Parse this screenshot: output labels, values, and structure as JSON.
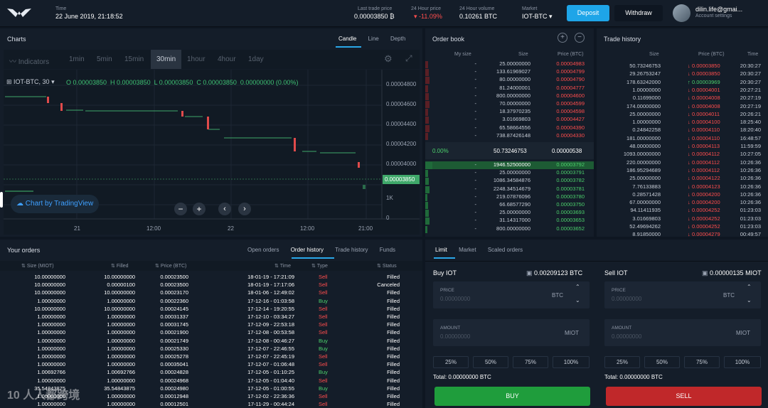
{
  "header": {
    "time_label": "Time",
    "time_value": "22 June 2019, 21:18:52",
    "last_price_label": "Last trade price",
    "last_price_value": "0.00003850 ₿",
    "change_label": "24 Hour price",
    "change_value": "-11.09%",
    "volume_label": "24 Hour volume",
    "volume_value": "0.10261 BTC",
    "market_label": "Market",
    "market_value": "IOT-BTC",
    "deposit": "Deposit",
    "withdraw": "Withdraw",
    "user": "dilin.life@gmai...",
    "account": "Account settings"
  },
  "charts": {
    "title": "Charts",
    "tabs": [
      "Candle",
      "Line",
      "Depth"
    ],
    "indicators": "Indicators",
    "intervals": [
      "1min",
      "5min",
      "15min",
      "30min",
      "1hour",
      "4hour",
      "1day"
    ],
    "symbol": "IOT-BTC, 30",
    "ohlc": "O 0.00003850  H 0.00003850  L 0.00003850  C 0.00003850  0.00000000 (0.00%)",
    "yticks": [
      "0.00004800",
      "0.00004600",
      "0.00004400",
      "0.00004200",
      "0.00004000"
    ],
    "current": "0.00003850",
    "vol_ticks": [
      "1K",
      "0"
    ],
    "xticks": [
      "21",
      "12:00",
      "22",
      "12:00",
      "21:00"
    ],
    "brand": "Chart by TradingView"
  },
  "orderbook": {
    "title": "Order book",
    "cols": [
      "My size",
      "Size",
      "Price (BTC)"
    ],
    "asks": [
      [
        "-",
        "25.00000000",
        "0.00004983"
      ],
      [
        "-",
        "133.61969027",
        "0.00004799"
      ],
      [
        "-",
        "80.00000000",
        "0.00004790"
      ],
      [
        "-",
        "81.24000001",
        "0.00004777"
      ],
      [
        "-",
        "800.00000000",
        "0.00004600"
      ],
      [
        "-",
        "70.00000000",
        "0.00004599"
      ],
      [
        "-",
        "18.37970235",
        "0.00004598"
      ],
      [
        "-",
        "3.01669803",
        "0.00004427"
      ],
      [
        "-",
        "65.58664556",
        "0.00004390"
      ],
      [
        "-",
        "738.87426148",
        "0.00004330"
      ]
    ],
    "spread": [
      "0.00%",
      "50.73246753",
      "0.00000538"
    ],
    "bids": [
      [
        "-",
        "1946.52500000",
        "0.00003792"
      ],
      [
        "-",
        "25.00000000",
        "0.00003791"
      ],
      [
        "-",
        "1086.34584876",
        "0.00003782"
      ],
      [
        "-",
        "2248.34514679",
        "0.00003781"
      ],
      [
        "-",
        "219.07876096",
        "0.00003780"
      ],
      [
        "-",
        "66.68577290",
        "0.00003750"
      ],
      [
        "-",
        "25.00000000",
        "0.00003693"
      ],
      [
        "-",
        "31.14317000",
        "0.00003653"
      ],
      [
        "-",
        "800.00000000",
        "0.00003652"
      ]
    ]
  },
  "trades": {
    "title": "Trade history",
    "cols": [
      "Size",
      "Price (BTC)",
      "Time"
    ],
    "rows": [
      [
        "50.73246753",
        "0.00003850",
        "20:30:27",
        "d"
      ],
      [
        "29.26753247",
        "0.00003850",
        "20:30:27",
        "d"
      ],
      [
        "178.63242000",
        "0.00003969",
        "20:30:27",
        "u"
      ],
      [
        "1.00000000",
        "0.00004001",
        "20:27:21",
        "d"
      ],
      [
        "0.11699000",
        "0.00004008",
        "20:27:19",
        "d"
      ],
      [
        "174.00000000",
        "0.00004008",
        "20:27:19",
        "d"
      ],
      [
        "25.00000000",
        "0.00004011",
        "20:26:21",
        "d"
      ],
      [
        "1.00000000",
        "0.00004100",
        "18:25:40",
        "d"
      ],
      [
        "0.24842258",
        "0.00004110",
        "18:20:40",
        "d"
      ],
      [
        "181.00000000",
        "0.00004110",
        "16:48:57",
        "d"
      ],
      [
        "48.00000000",
        "0.00004113",
        "11:59:59",
        "d"
      ],
      [
        "1093.00000000",
        "0.00004112",
        "10:27:05",
        "d"
      ],
      [
        "220.00000000",
        "0.00004112",
        "10:26:36",
        "d"
      ],
      [
        "186.95294689",
        "0.00004112",
        "10:26:36",
        "d"
      ],
      [
        "25.00000000",
        "0.00004122",
        "10:26:36",
        "d"
      ],
      [
        "7.76133883",
        "0.00004123",
        "10:26:36",
        "d"
      ],
      [
        "0.28571428",
        "0.00004200",
        "10:26:36",
        "d"
      ],
      [
        "67.00000000",
        "0.00004200",
        "10:26:36",
        "d"
      ],
      [
        "94.11411935",
        "0.00004252",
        "01:23:03",
        "d"
      ],
      [
        "3.01669803",
        "0.00004252",
        "01:23:03",
        "d"
      ],
      [
        "52.49694262",
        "0.00004252",
        "01:23:03",
        "d"
      ],
      [
        "8.91850000",
        "0.00004279",
        "00:49:57",
        "d"
      ]
    ]
  },
  "orders": {
    "title": "Your orders",
    "tabs": [
      "Open orders",
      "Order history",
      "Trade history",
      "Funds"
    ],
    "cols": [
      "Size (MIOT)",
      "Filled",
      "Price (BTC)",
      "Time",
      "Type",
      "Status"
    ],
    "rows": [
      [
        "10.00000000",
        "10.00000000",
        "0.00023500",
        "18-01-19 - 17:21:09",
        "Sell",
        "Filled"
      ],
      [
        "10.00000000",
        "0.00000100",
        "0.00023500",
        "18-01-19 - 17:17:06",
        "Sell",
        "Canceled"
      ],
      [
        "10.00000000",
        "10.00000000",
        "0.00023170",
        "18-01-06 - 12:49:02",
        "Sell",
        "Filled"
      ],
      [
        "1.00000000",
        "1.00000000",
        "0.00022360",
        "17-12-16 - 01:03:58",
        "Buy",
        "Filled"
      ],
      [
        "10.00000000",
        "10.00000000",
        "0.00024145",
        "17-12-14 - 19:20:55",
        "Sell",
        "Filled"
      ],
      [
        "1.00000000",
        "1.00000000",
        "0.00031337",
        "17-12-10 - 03:34:27",
        "Sell",
        "Filled"
      ],
      [
        "1.00000000",
        "1.00000000",
        "0.00031745",
        "17-12-09 - 22:53:18",
        "Sell",
        "Filled"
      ],
      [
        "1.00000000",
        "1.00000000",
        "0.00021900",
        "17-12-08 - 00:53:58",
        "Sell",
        "Filled"
      ],
      [
        "1.00000000",
        "1.00000000",
        "0.00021749",
        "17-12-08 - 00:46:27",
        "Buy",
        "Filled"
      ],
      [
        "1.00000000",
        "1.00000000",
        "0.00025330",
        "17-12-07 - 22:46:55",
        "Buy",
        "Filled"
      ],
      [
        "1.00000000",
        "1.00000000",
        "0.00025278",
        "17-12-07 - 22:45:19",
        "Sell",
        "Filled"
      ],
      [
        "1.00000000",
        "1.00000000",
        "0.00035041",
        "17-12-07 - 01:06:48",
        "Sell",
        "Filled"
      ],
      [
        "1.00692766",
        "1.00692766",
        "0.00024828",
        "17-12-05 - 01:10:25",
        "Buy",
        "Filled"
      ],
      [
        "1.00000000",
        "1.00000000",
        "0.00024968",
        "17-12-05 - 01:04:40",
        "Sell",
        "Filled"
      ],
      [
        "35.54843875",
        "35.54843875",
        "0.00024980",
        "17-12-05 - 01:00:55",
        "Buy",
        "Filled"
      ],
      [
        "1.00000000",
        "1.00000000",
        "0.00012948",
        "17-12-02 - 22:36:36",
        "Sell",
        "Filled"
      ],
      [
        "1.00000000",
        "1.00000000",
        "0.00012501",
        "17-11-29 - 00:44:24",
        "Sell",
        "Filled"
      ]
    ]
  },
  "trade_form": {
    "tabs": [
      "Limit",
      "Market",
      "Scaled orders"
    ],
    "buy": {
      "title": "Buy IOT",
      "balance": "0.00209123 BTC",
      "price_label": "PRICE",
      "price_ph": "0.00000000",
      "price_unit": "BTC",
      "amount_label": "AMOUNT",
      "amount_ph": "0.00000000",
      "amount_unit": "MIOT",
      "pcts": [
        "25%",
        "50%",
        "75%",
        "100%"
      ],
      "total": "Total: 0.00000000 BTC",
      "action": "BUY"
    },
    "sell": {
      "title": "Sell IOT",
      "balance": "0.00000135 MIOT",
      "price_label": "PRICE",
      "price_ph": "0.00000000",
      "price_unit": "BTC",
      "amount_label": "AMOUNT",
      "amount_ph": "0.00000000",
      "amount_unit": "MIOT",
      "pcts": [
        "25%",
        "50%",
        "75%",
        "100%"
      ],
      "total": "Total: 0.00000000 BTC",
      "action": "SELL"
    }
  },
  "watermark": "10 人人都跨境"
}
